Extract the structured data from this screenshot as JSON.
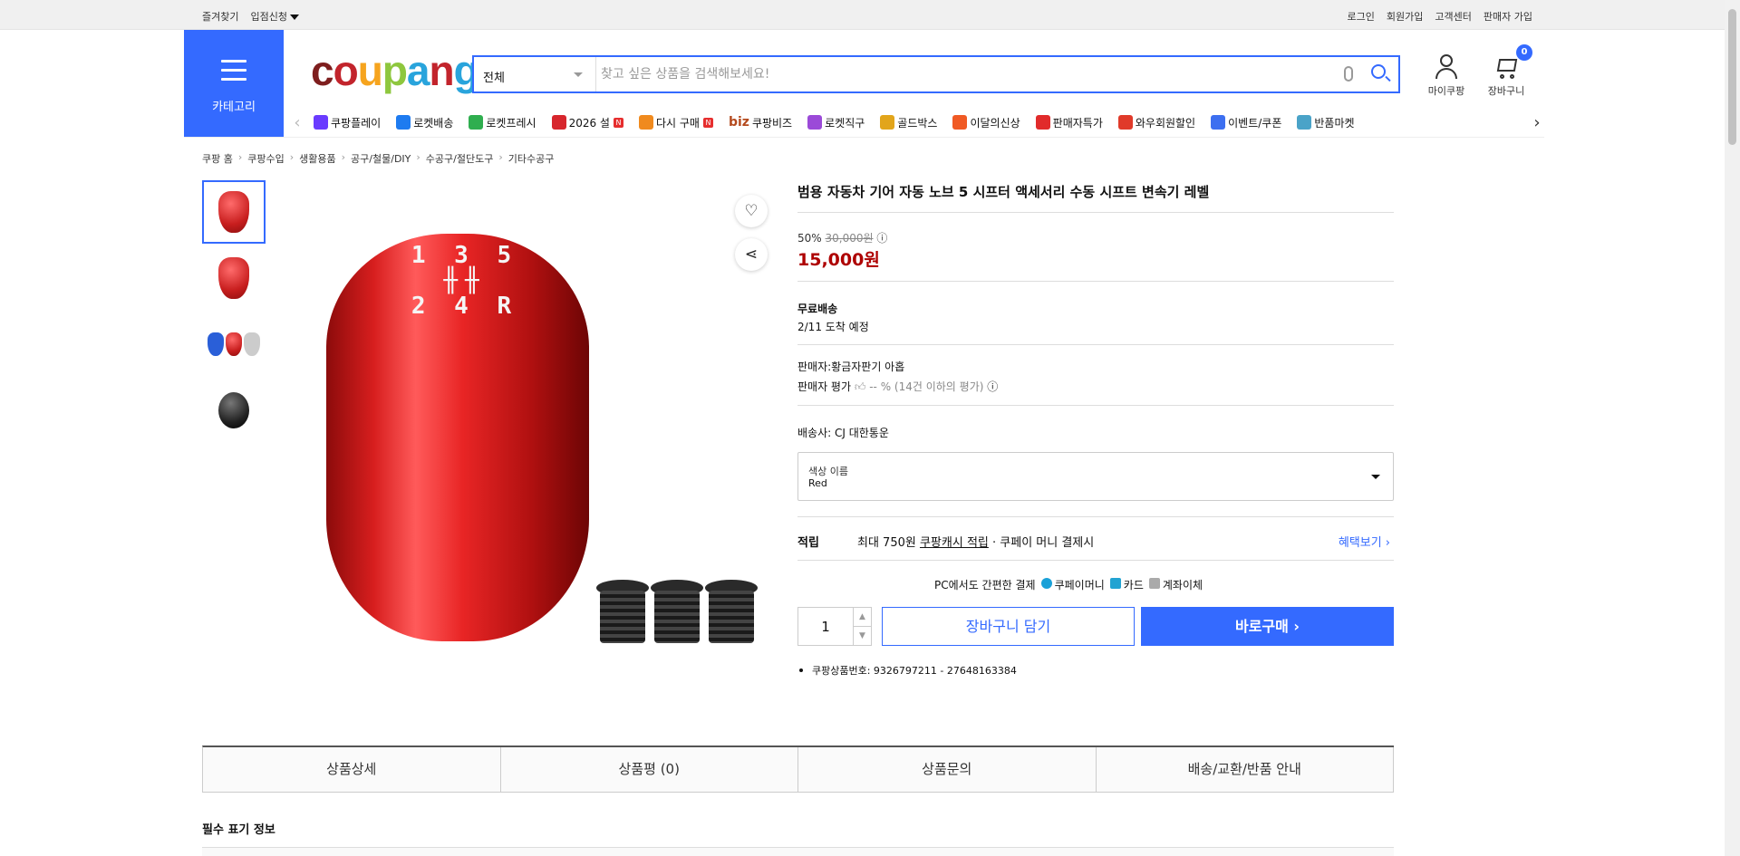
{
  "topbar": {
    "left": [
      "즐겨찾기",
      "입점신청"
    ],
    "right": [
      "로그인",
      "회원가입",
      "고객센터",
      "판매자 가입"
    ]
  },
  "category_label": "카테고리",
  "logo": {
    "c1": "c",
    "c2": "o",
    "c3": "u",
    "c4": "p",
    "c5": "a",
    "c6": "n",
    "c7": "g"
  },
  "search": {
    "category": "전체",
    "placeholder": "찾고 싶은 상품을 검색해보세요!"
  },
  "user": {
    "mycoupang": "마이쿠팡",
    "cart": "장바구니",
    "cart_count": "0"
  },
  "quick_menu": [
    {
      "label": "쿠팡플레이",
      "color": "#6a3bff"
    },
    {
      "label": "로켓배송",
      "color": "#1e7bf0"
    },
    {
      "label": "로켓프레시",
      "color": "#2fae4f"
    },
    {
      "label": "2026 설",
      "color": "#d7262d",
      "new": "N"
    },
    {
      "label": "다시 구매",
      "color": "#f08a1e",
      "new": "N"
    },
    {
      "label": "쿠팡비즈",
      "color": "#b44a1e",
      "prefix": "biz"
    },
    {
      "label": "로켓직구",
      "color": "#9b4ad8"
    },
    {
      "label": "골드박스",
      "color": "#e2a51b"
    },
    {
      "label": "이달의신상",
      "color": "#f05a24"
    },
    {
      "label": "판매자특가",
      "color": "#e12b2b"
    },
    {
      "label": "와우회원할인",
      "color": "#e03a2a"
    },
    {
      "label": "이벤트/쿠폰",
      "color": "#3d6ff0"
    },
    {
      "label": "반품마켓",
      "color": "#4aa3c8"
    }
  ],
  "breadcrumb": [
    "쿠팡 홈",
    "쿠팡수입",
    "생활용품",
    "공구/철물/DIY",
    "수공구/절단도구",
    "기타수공구"
  ],
  "product": {
    "title": "범용 자동차 기어 자동 노브 5 시프터 액세서리 수동 시프트 변속기 레벨",
    "discount": "50%",
    "original_price": "30,000원",
    "price": "15,000원",
    "shipping_label": "무료배송",
    "arrival": "2/11 도착 예정",
    "seller": "판매자:황금자판기 아홉",
    "seller_rating_label": "판매자 평가",
    "seller_rating": "-- % (14건 이하의 평가)",
    "courier": "배송사:  CJ 대한통운",
    "knob_text_top": "1 3 5",
    "knob_text_bottom": "2 4 R",
    "option_label": "색상 이름",
    "option_value": "Red",
    "reward_label": "적립",
    "reward_text1": "최대 750원",
    "reward_text2": "쿠팡캐시 적립",
    "reward_text3": "· 쿠페이 머니 결제시",
    "reward_more": "혜택보기 ›",
    "pay_label": "PC에서도 간편한 결제",
    "pay_methods": [
      "쿠페이머니",
      "카드",
      "계좌이체"
    ],
    "quantity": "1",
    "add_cart": "장바구니 담기",
    "buy_now": "바로구매 ›",
    "product_no": "쿠팡상품번호: 9326797211 - 27648163384"
  },
  "tabs": [
    "상품상세",
    "상품평 (0)",
    "상품문의",
    "배송/교환/반품 안내"
  ],
  "required_info": "필수 표기 정보"
}
